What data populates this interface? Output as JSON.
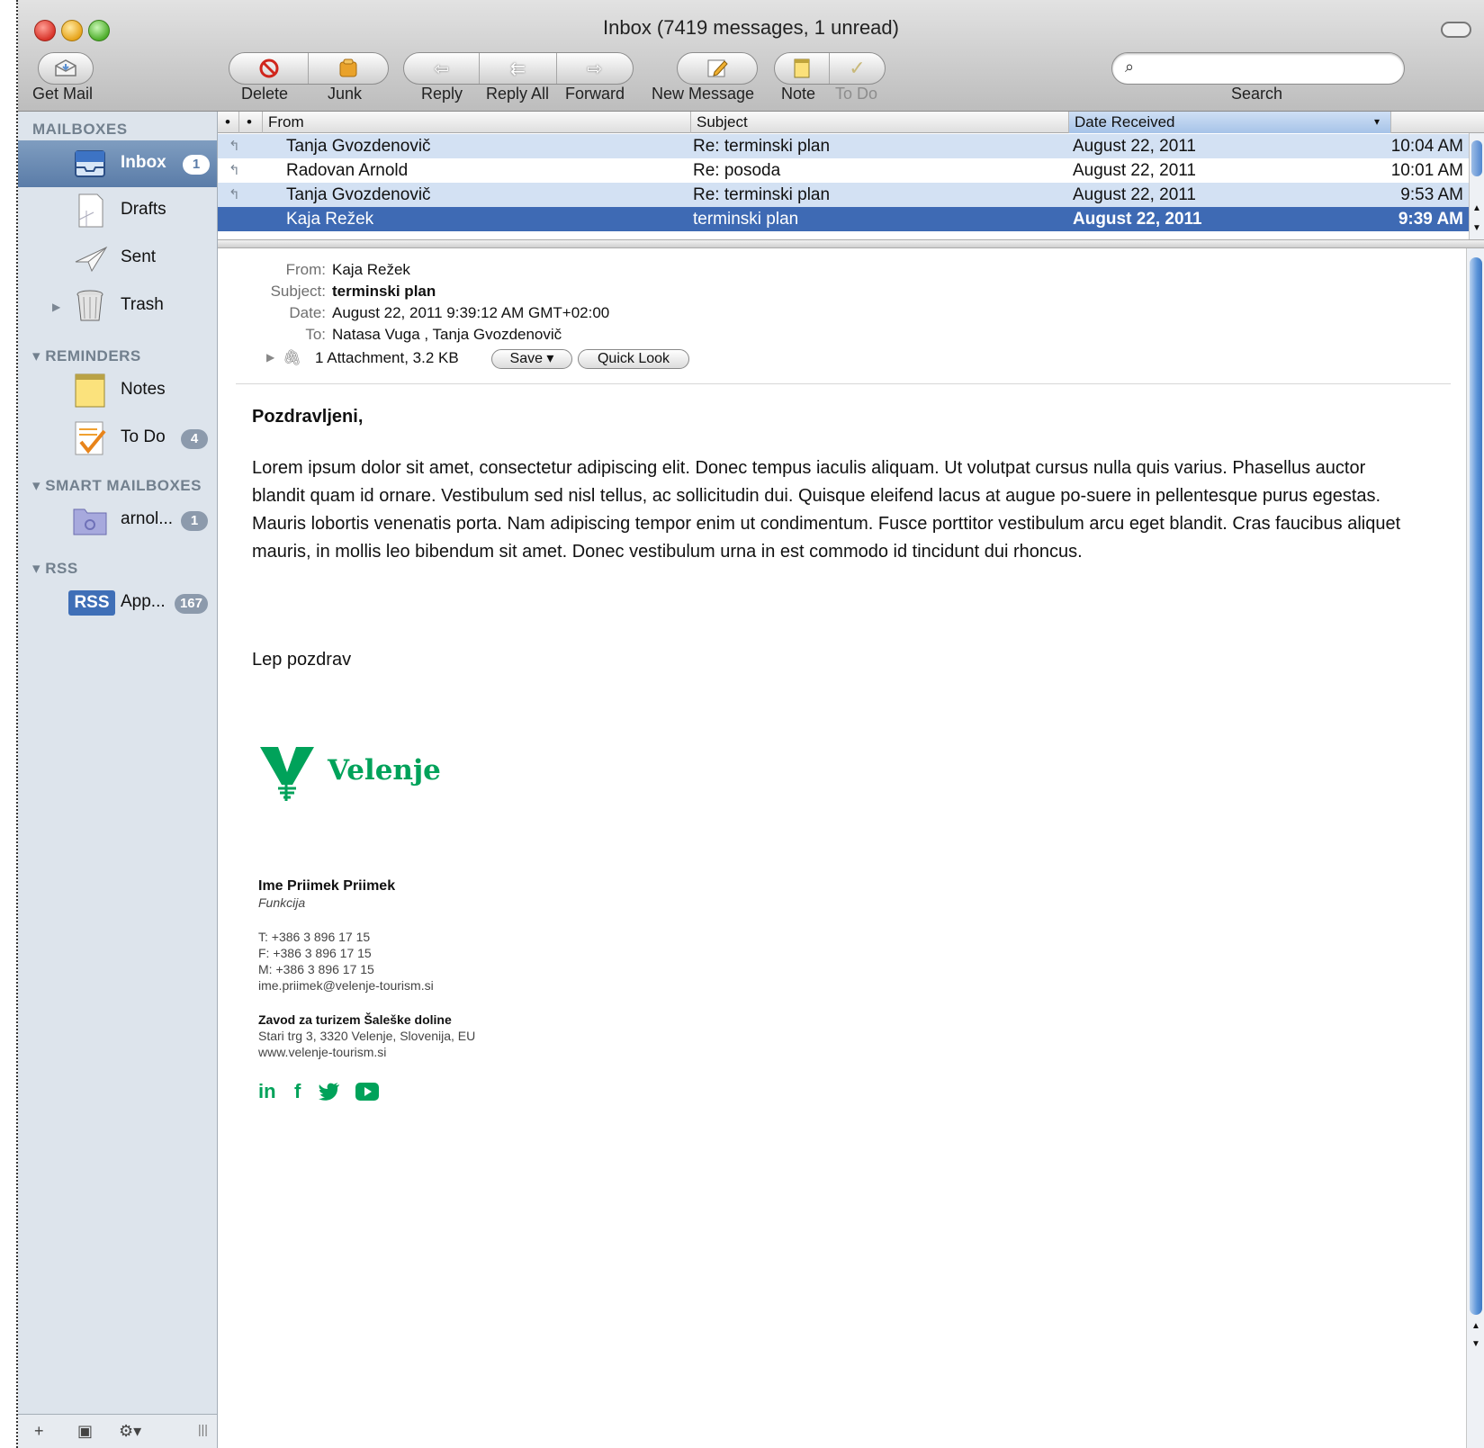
{
  "window": {
    "title": "Inbox (7419 messages, 1 unread)"
  },
  "toolbar": {
    "get_mail": "Get Mail",
    "delete": "Delete",
    "junk": "Junk",
    "reply": "Reply",
    "reply_all": "Reply All",
    "forward": "Forward",
    "new_message": "New Message",
    "note": "Note",
    "to_do": "To Do",
    "search_label": "Search",
    "search_placeholder": ""
  },
  "sidebar": {
    "mailboxes_header": "MAILBOXES",
    "reminders_header": "REMINDERS",
    "smart_header": "SMART MAILBOXES",
    "rss_header": "RSS",
    "inbox": {
      "label": "Inbox",
      "badge": "1"
    },
    "drafts": {
      "label": "Drafts"
    },
    "sent": {
      "label": "Sent"
    },
    "trash": {
      "label": "Trash"
    },
    "notes": {
      "label": "Notes"
    },
    "todo": {
      "label": "To Do",
      "badge": "4"
    },
    "smart": {
      "label": "arnol...",
      "badge": "1"
    },
    "rss": {
      "icon_text": "RSS",
      "label": "App...",
      "badge": "167"
    }
  },
  "list": {
    "columns": {
      "from": "From",
      "subject": "Subject",
      "date": "Date Received"
    },
    "rows": [
      {
        "from": "Tanja Gvozdenovič",
        "subject": "Re: terminski plan",
        "date": "August 22, 2011",
        "time": "10:04 AM"
      },
      {
        "from": "Radovan Arnold",
        "subject": "Re: posoda",
        "date": "August 22, 2011",
        "time": "10:01 AM"
      },
      {
        "from": "Tanja Gvozdenovič",
        "subject": "Re: terminski plan",
        "date": "August 22, 2011",
        "time": "9:53 AM"
      },
      {
        "from": "Kaja Režek",
        "subject": "terminski plan",
        "date": "August 22, 2011",
        "time": "9:39 AM"
      }
    ]
  },
  "message": {
    "from_label": "From:",
    "from": "Kaja Režek",
    "subject_label": "Subject:",
    "subject": "terminski plan",
    "date_label": "Date:",
    "date": "August 22, 2011 9:39:12 AM GMT+02:00",
    "to_label": "To:",
    "to": "Natasa Vuga ,  Tanja Gvozdenovič",
    "attachment": "1 Attachment, 3.2 KB",
    "save_button": "Save ▾",
    "quick_look_button": "Quick Look",
    "greeting": "Pozdravljeni,",
    "body": "Lorem ipsum dolor sit amet, consectetur adipiscing elit. Donec tempus iaculis aliquam. Ut volutpat cursus nulla quis varius. Phasellus auctor blandit quam id ornare. Vestibulum sed nisl tellus, ac sollicitudin dui. Quisque eleifend lacus at augue po-suere in pellentesque purus egestas. Mauris lobortis venenatis porta. Nam adipiscing tempor enim ut condimentum. Fusce porttitor vestibulum arcu eget blandit. Cras faucibus aliquet mauris, in mollis leo bibendum sit amet. Donec vestibulum urna in est commodo id tincidunt dui rhoncus.",
    "closing": "Lep pozdrav"
  },
  "signature": {
    "logo_text": "Velenje",
    "name": "Ime Priimek Priimek",
    "role": "Funkcija",
    "phone": "T: +386 3 896 17 15",
    "fax": "F: +386 3 896 17 15",
    "mobile": "M: +386 3 896 17 15",
    "email": "ime.priimek@velenje-tourism.si",
    "org": "Zavod za turizem Šaleške doline",
    "address": "Stari trg 3, 3320 Velenje, Slovenija, EU",
    "website": "www.velenje-tourism.si",
    "social": {
      "linkedin": "in",
      "facebook": "f"
    }
  },
  "colors": {
    "selection": "#3e6ab4",
    "alt_row": "#d3e1f3",
    "sidebar": "#dde4ec",
    "brand_green": "#00a25a"
  }
}
